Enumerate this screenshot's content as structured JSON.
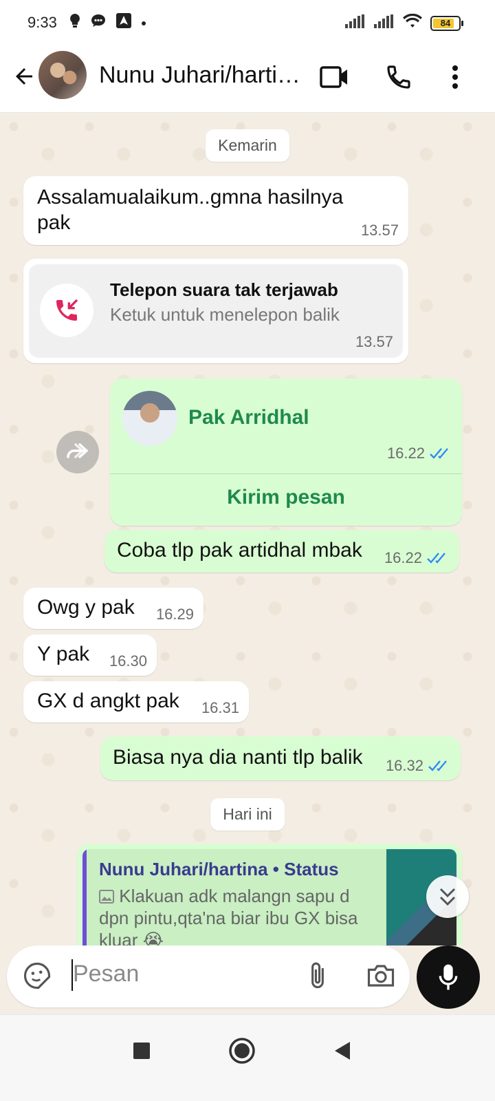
{
  "status_bar": {
    "time": "9:33",
    "battery": "84",
    "battery_percent": 84
  },
  "header": {
    "contact_name": "Nunu Juhari/hartina Sidan",
    "icons": [
      "back-arrow-icon",
      "video-call-icon",
      "voice-call-icon",
      "more-options-icon"
    ]
  },
  "chat": {
    "date_yesterday": "Kemarin",
    "date_today": "Hari ini",
    "messages": [
      {
        "text": "Assalamualaikum..gmna hasilnya pak",
        "time": "13.57",
        "direction": "in"
      },
      {
        "call_title": "Telepon suara tak terjawab",
        "call_subtitle": "Ketuk untuk menelepon balik",
        "time": "13.57",
        "direction": "in"
      },
      {
        "contact_name": "Pak Arridhal",
        "action": "Kirim pesan",
        "time": "16.22",
        "direction": "out"
      },
      {
        "text": "Coba tlp pak artidhal mbak",
        "time": "16.22",
        "direction": "out"
      },
      {
        "text": "Owg y pak",
        "time": "16.29",
        "direction": "in"
      },
      {
        "text": "Y pak",
        "time": "16.30",
        "direction": "in"
      },
      {
        "text": "GX d angkt pak",
        "time": "16.31",
        "direction": "in"
      },
      {
        "text": "Biasa nya dia nanti tlp balik",
        "time": "16.32",
        "direction": "out"
      },
      {
        "quote_author": "Nunu Juhari/hartina • Status",
        "quote_text": "Klakuan adk malangn sapu d dpn pintu,qta'na biar ibu GX bisa kluar 😭",
        "direction": "out"
      }
    ]
  },
  "composer": {
    "placeholder": "Pesan"
  },
  "colors": {
    "chat_bg": "#f3ede3",
    "outgoing_bubble": "#d9fdd3",
    "incoming_bubble": "#ffffff",
    "accent_green": "#1f8a4c",
    "read_ticks": "#2d8cf0",
    "missed_call_red": "#e0245e"
  }
}
